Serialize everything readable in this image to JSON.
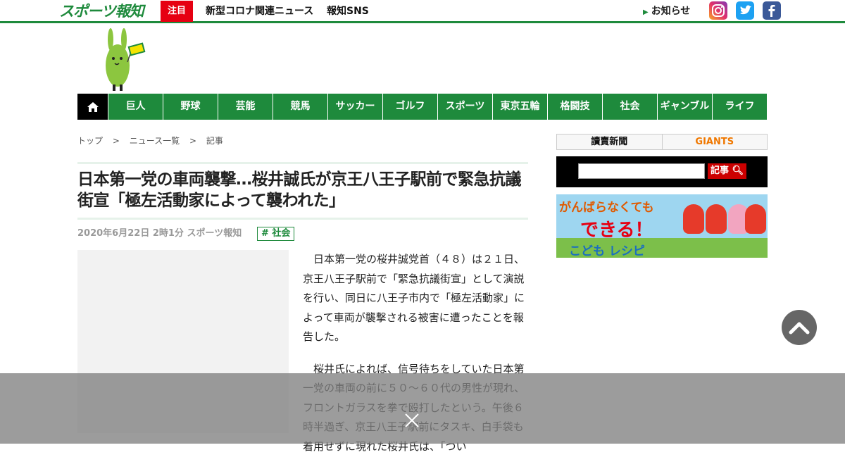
{
  "header": {
    "logo_text": "スポーツ報知",
    "attention_label": "注目",
    "links": [
      "新型コロナ関連ニュース",
      "報知SNS"
    ],
    "notice_label": "お知らせ",
    "sns": [
      "instagram",
      "twitter",
      "facebook"
    ]
  },
  "nav": {
    "items": [
      "巨人",
      "野球",
      "芸能",
      "競馬",
      "サッカー",
      "ゴルフ",
      "スポーツ",
      "東京五輪",
      "格闘技",
      "社会",
      "ギャンブル",
      "ライフ"
    ]
  },
  "breadcrumb": [
    "トップ",
    ">",
    "ニュース一覧",
    ">",
    "記事"
  ],
  "article": {
    "title": "日本第一党の車両襲撃…桜井誠氏が京王八王子駅前で緊急抗議街宣「極左活動家によって襲われた」",
    "meta": "2020年6月22日 2時1分  スポーツ報知",
    "tag": "# 社会",
    "paragraphs": [
      "日本第一党の桜井誠党首（４８）は２１日、京王八王子駅前で「緊急抗議街宣」として演説を行い、同日に八王子市内で「極左活動家」によって車両が襲撃される被害に遭ったことを報告した。",
      "桜井氏によれば、信号待ちをしていた日本第一党の車両の前に５０～６０代の男性が現れ、フロントガラスを拳で殴打したという。午後６時半過ぎ、京王八王子駅前にタスキ、白手袋も着用せずに現れた桜井氏は、「つい"
    ]
  },
  "sidebar": {
    "yomiuri_label": "讀賣新聞",
    "giants_label": "GIANTS",
    "search_button": "記事",
    "recipe_line1": "がんばらなくても",
    "recipe_line2": "できる！",
    "recipe_line3": "こども レシピ"
  },
  "colors": {
    "brand_green": "#1e8a3c",
    "accent_red": "#e60012"
  }
}
